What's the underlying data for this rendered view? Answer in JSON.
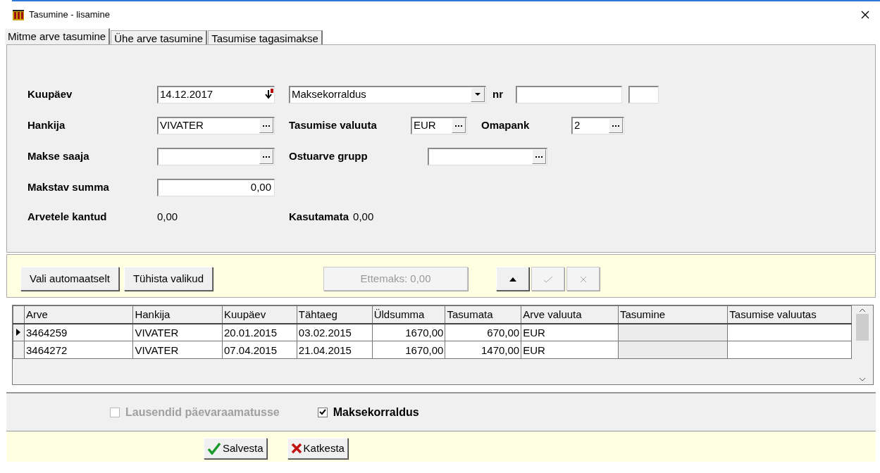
{
  "window": {
    "title": "Tasumine - lisamine"
  },
  "tabs": [
    {
      "label": "Mitme arve tasumine",
      "selected": true
    },
    {
      "label": "Ühe arve tasumine",
      "selected": false
    },
    {
      "label": "Tasumise tagasimakse",
      "selected": false
    }
  ],
  "form": {
    "date_label": "Kuupäev",
    "date": "14.12.2017",
    "doc_type": "Maksekorraldus",
    "nr_label": "nr",
    "supplier_label": "Hankija",
    "supplier": "VIVATER",
    "currency_label": "Tasumise valuuta",
    "currency": "EUR",
    "bank_label": "Omapank",
    "bank": "2",
    "payee_label": "Makse saaja",
    "group_label": "Ostuarve grupp",
    "amount_label": "Makstav summa",
    "amount": "0,00",
    "posted_label": "Arvetele kantud",
    "posted": "0,00",
    "unused_label": "Kasutamata",
    "unused": "0,00"
  },
  "toolbar": [
    {
      "kind": "text",
      "label": "Vali automaatselt",
      "disabled": false
    },
    {
      "kind": "text",
      "label": "Tühista valikud",
      "disabled": false
    },
    {
      "kind": "text",
      "label": "Ettemaks: 0,00",
      "disabled": true
    },
    {
      "kind": "up",
      "disabled": false
    },
    {
      "kind": "check",
      "disabled": true
    },
    {
      "kind": "cross",
      "disabled": true
    }
  ],
  "table": {
    "columns": [
      "Arve",
      "Hankija",
      "Kuupäev",
      "Tähtaeg",
      "Üldsumma",
      "Tasumata",
      "Arve valuuta",
      "Tasumine",
      "Tasumise valuutas"
    ],
    "rows": [
      {
        "selected": true,
        "cells": [
          "3464259",
          "VIVATER",
          "20.01.2015",
          "03.02.2015",
          "1670,00",
          "670,00",
          "EUR",
          "",
          ""
        ]
      },
      {
        "selected": false,
        "cells": [
          "3464272",
          "VIVATER",
          "07.04.2015",
          "21.04.2015",
          "1670,00",
          "1470,00",
          "EUR",
          "",
          ""
        ]
      }
    ]
  },
  "options": [
    {
      "label": "Lausendid päevaraamatusse",
      "checked": false,
      "disabled": true
    },
    {
      "label": "Maksekorraldus",
      "checked": true,
      "disabled": false
    }
  ],
  "buttons": [
    {
      "kind": "save",
      "label": "Salvesta"
    },
    {
      "kind": "cancel",
      "label": "Katkesta"
    }
  ]
}
